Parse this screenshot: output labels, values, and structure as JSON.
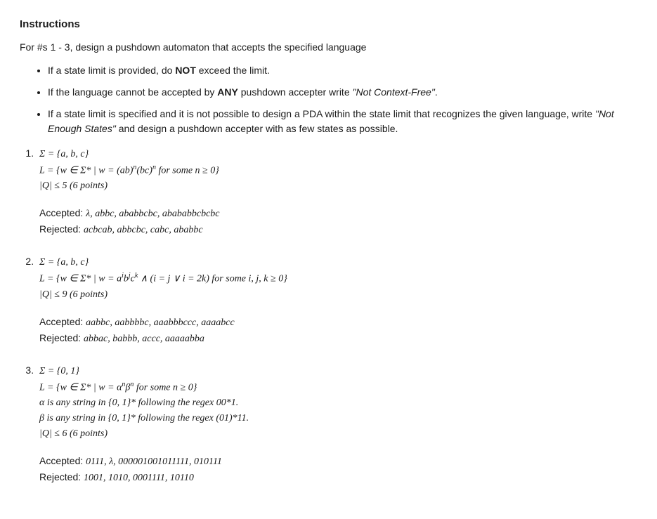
{
  "title": "Instructions",
  "intro": "For #s 1 - 3, design a pushdown automaton that accepts the specified language",
  "bullets": [
    {
      "before": "If a state limit is provided, do ",
      "bold": "NOT",
      "after": " exceed the limit."
    },
    {
      "before": "If the language cannot be accepted by ",
      "bold": "ANY",
      "after": " pushdown accepter write ",
      "quoted": "\"Not Context-Free\"",
      "tail": "."
    },
    {
      "before": "If a state limit is specified and it is not possible to design a PDA within the state limit that recognizes the given language, write ",
      "quoted": "\"Not Enough States\"",
      "after": " and design a pushdown accepter with as few states as possible."
    }
  ],
  "problems": [
    {
      "sigma": "Σ = {a, b, c}",
      "lang_html": "L = {w ∈ Σ* | w = (ab)<span class='sup'>n</span>(bc)<span class='sup'>n</span> for some n ≥ 0}",
      "q": "|Q| ≤ 5 (6 points)",
      "accepted": "λ, abbc, ababbcbc, abababbcbcbc",
      "rejected": "acbcab, abbcbc, cabc, ababbc"
    },
    {
      "sigma": "Σ = {a, b, c}",
      "lang_html": "L = {w ∈ Σ* | w = a<span class='sup'>i</span>b<span class='sup'>j</span>c<span class='sup'>k</span> ∧ (i = j ∨ i = 2k) for some i, j, k ≥ 0}",
      "q": "|Q| ≤ 9 (6 points)",
      "accepted": "aabbc, aabbbbc, aaabbbccc, aaaabcc",
      "rejected": "abbac, babbb, accc, aaaaabba"
    },
    {
      "sigma": "Σ = {0, 1}",
      "lang_html": "L = {w ∈ Σ* | w = α<span class='sup'>n</span>β<span class='sup'>n</span> for some n ≥ 0}",
      "extra": [
        "α is any string in {0, 1}* following the regex 00*1.",
        "β is any string in {0, 1}* following the regex (01)*11."
      ],
      "q": "|Q| ≤ 6 (6 points)",
      "accepted": "0111, λ, 000001001011111, 010111",
      "rejected": "1001, 1010, 0001111, 10110"
    }
  ],
  "labels": {
    "accepted": "Accepted: ",
    "rejected": "Rejected: "
  }
}
